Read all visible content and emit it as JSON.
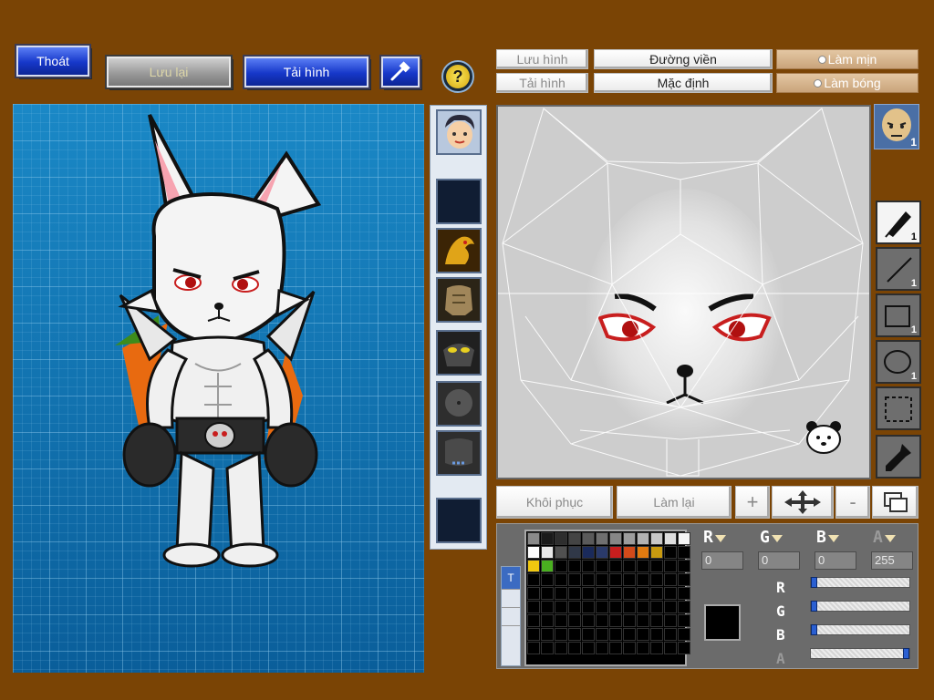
{
  "top_buttons": {
    "exit": "Thoát",
    "save": "Lưu lại",
    "load": "Tải hình"
  },
  "editor_buttons": {
    "save_image": "Lưu hình",
    "load_image": "Tải hình",
    "outline": "Đường viền",
    "default": "Mặc định",
    "smooth": "Làm mịn",
    "shade": "Làm bóng",
    "restore": "Khôi phục",
    "redo": "Làm lại",
    "plus": "+",
    "minus": "-"
  },
  "tools": {
    "pen_count": "1",
    "line_count": "1",
    "rect_count": "1",
    "ellipse_count": "1",
    "avatar_badge": "1"
  },
  "color": {
    "r_value": "0",
    "g_value": "0",
    "b_value": "0",
    "a_value": "255",
    "r_fraction": 0,
    "g_fraction": 0,
    "b_fraction": 0,
    "a_fraction": 1,
    "current": "#000000",
    "palette_row1": [
      "#8a8a8a",
      "#1a1a1a",
      "#2e2e2e",
      "#444",
      "#5a5a5a",
      "#707070",
      "#868686",
      "#9c9c9c",
      "#b2b2b2",
      "#c8c8c8",
      "#dedede",
      "#f4f4f4"
    ],
    "palette_row2": [
      "#ffffff",
      "#e8e8e8",
      "#505050",
      "#303848",
      "#1a2a5a",
      "#2a3a6a",
      "#c81e1e",
      "#d24a1a",
      "#e07a10",
      "#c89a10",
      "#000",
      "#000"
    ],
    "palette_row3": [
      "#f0c810",
      "#4ab020",
      "#000",
      "#000",
      "#000",
      "#000",
      "#000",
      "#000",
      "#000",
      "#000",
      "#000",
      "#000"
    ]
  },
  "channel_labels": {
    "r": "R",
    "g": "G",
    "b": "B",
    "a": "A"
  },
  "side_tab": {
    "label": "T"
  }
}
